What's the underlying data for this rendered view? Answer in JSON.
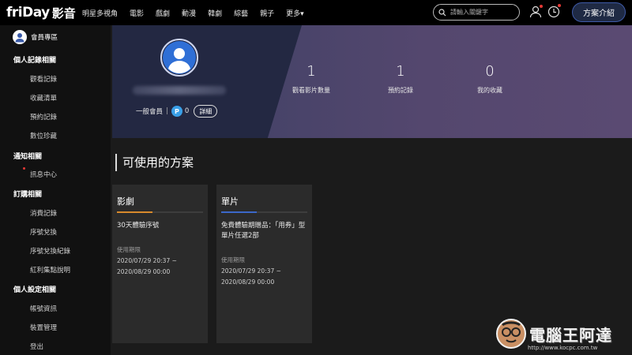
{
  "brand": {
    "logo": "friDay",
    "sub": "影音"
  },
  "nav": {
    "items": [
      "明星多視角",
      "電影",
      "戲劇",
      "動漫",
      "韓劇",
      "綜藝",
      "親子",
      "更多▾"
    ],
    "search_placeholder": "請輸入關鍵字",
    "plan_button": "方案介紹"
  },
  "sidebar": {
    "member_area": "會員專區",
    "groups": [
      {
        "title": "個人記錄相關",
        "items": [
          "觀看記錄",
          "收藏清單",
          "預約記錄",
          "數位珍藏"
        ]
      },
      {
        "title": "通知相關",
        "items": [
          "訊息中心"
        ]
      },
      {
        "title": "訂購相關",
        "items": [
          "消費記錄",
          "序號兌換",
          "序號兌換紀錄",
          "紅利集點說明"
        ]
      },
      {
        "title": "個人設定相關",
        "items": [
          "帳號資訊",
          "裝置管理",
          "登出"
        ]
      }
    ]
  },
  "profile": {
    "member_type": "一般會員",
    "points": "0",
    "detail_button": "詳細",
    "stats": [
      {
        "value": "1",
        "label": "觀看影片數量"
      },
      {
        "value": "1",
        "label": "預約記錄"
      },
      {
        "value": "0",
        "label": "我的收藏"
      }
    ]
  },
  "plans": {
    "title": "可使用的方案",
    "cards": [
      {
        "title": "影劇",
        "accent": "#d88a2c",
        "desc": "30天體驗序號",
        "period_label": "使用期限",
        "start": "2020/07/29 20:37 ~",
        "end": "2020/08/29 00:00"
      },
      {
        "title": "單片",
        "accent": "#3b68c9",
        "desc": "免費體驗期贈品：「用券」型單片任選2部",
        "period_label": "使用期限",
        "start": "2020/07/29 20:37 ~",
        "end": "2020/08/29 00:00"
      }
    ]
  },
  "watermark": {
    "text": "電腦王阿達",
    "url": "http://www.kocpc.com.tw"
  }
}
